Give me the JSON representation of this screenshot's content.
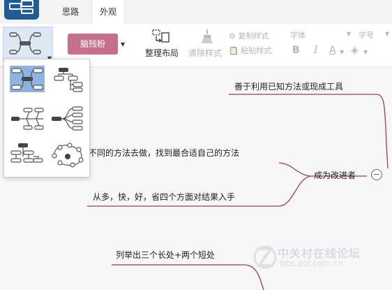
{
  "tabs": [
    {
      "label": "思路",
      "active": false
    },
    {
      "label": "外观",
      "active": true
    }
  ],
  "ribbon": {
    "skin_label": "脑残粉",
    "skin_color": "#c5718c",
    "tidy_label": "整理布局",
    "clear_label": "清除样式",
    "copy_style_label": "复制样式",
    "paste_style_label": "粘贴样式",
    "font_label": "字体",
    "size_label": "字号",
    "bold_label": "B",
    "italic_label": "I",
    "font_color_label": "A"
  },
  "mindmap": {
    "nodes": [
      {
        "text": "善于利用已知方法或现成工具"
      },
      {
        "text": "不同的方法去做，找到最合适自己的方法"
      },
      {
        "text": "成为改进者"
      },
      {
        "text": "从多，快，好，省四个方面对结果入手"
      },
      {
        "text": "列举出三个长处+两个短处"
      }
    ],
    "line_color": "#9b3b5c"
  },
  "structure_menu": {
    "options": [
      {
        "icon": "mind-map-layout-icon",
        "selected": true
      },
      {
        "icon": "org-chart-layout-icon",
        "selected": false
      },
      {
        "icon": "fishbone-layout-icon",
        "selected": false
      },
      {
        "icon": "logic-left-layout-icon",
        "selected": false
      },
      {
        "icon": "tree-layout-icon",
        "selected": false
      },
      {
        "icon": "network-layout-icon",
        "selected": false
      }
    ]
  },
  "watermark": {
    "title": "中关村在线论坛",
    "url": "bbs.zol.com.cn"
  }
}
